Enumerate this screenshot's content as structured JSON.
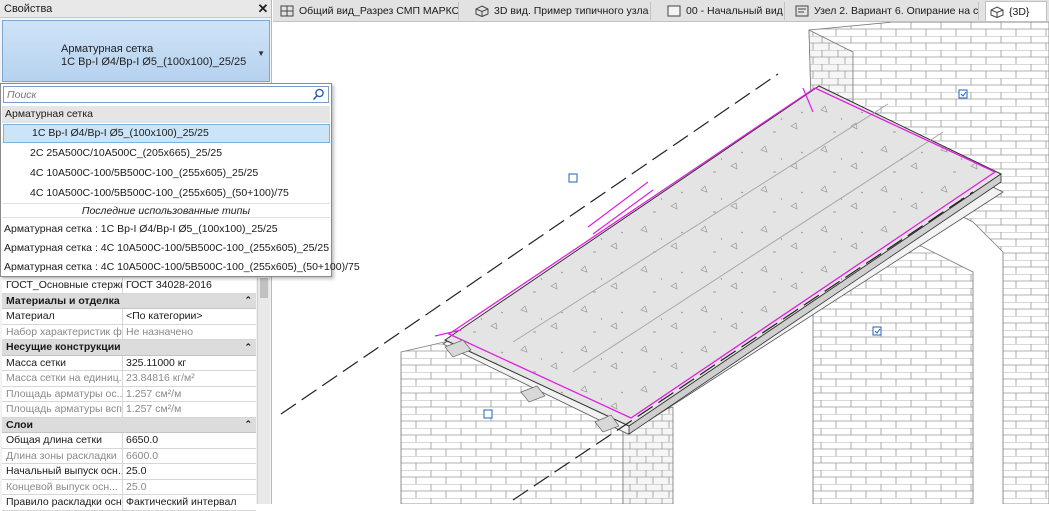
{
  "panel": {
    "title": "Свойства",
    "type_line1": "Арматурная сетка",
    "type_line2": "1С Вр-I Ø4/Вр-I Ø5_(100x100)_25/25"
  },
  "dropdown": {
    "search_placeholder": "Поиск",
    "group_label": "Арматурная сетка",
    "items": [
      "1С Вр-I Ø4/Вр-I Ø5_(100x100)_25/25",
      "2С 25А500С/10А500С_(205x665)_25/25",
      "4С 10А500С-100/5В500С-100_(255x605)_25/25",
      "4С 10А500С-100/5В500С-100_(255x605)_(50+100)/75"
    ],
    "recent_label": "Последние использованные типы",
    "recent": [
      "Арматурная сетка : 1С Вр-I Ø4/Вр-I Ø5_(100x100)_25/25",
      "Арматурная сетка : 4С 10А500С-100/5В500С-100_(255x605)_25/25",
      "Арматурная сетка : 4С 10А500С-100/5В500С-100_(255x605)_(50+100)/75"
    ]
  },
  "grid": {
    "top_row": {
      "k": "ГОСТ_Основные стержни",
      "v": "ГОСТ 34028-2016"
    },
    "groups": [
      {
        "label": "Материалы и отделка",
        "rows": [
          {
            "k": "Материал",
            "v": "<По категории>",
            "ro": false
          },
          {
            "k": "Набор характеристик ф...",
            "v": "Не назначено",
            "ro": true
          }
        ]
      },
      {
        "label": "Несущие конструкции",
        "rows": [
          {
            "k": "Масса сетки",
            "v": "325.11000 кг",
            "ro": false
          },
          {
            "k": "Масса сетки на единиц...",
            "v": "23.84816 кг/м²",
            "ro": true
          },
          {
            "k": "Площадь арматуры ос...",
            "v": "1.257 см²/м",
            "ro": true
          },
          {
            "k": "Площадь арматуры всп...",
            "v": "1.257 см²/м",
            "ro": true
          }
        ]
      },
      {
        "label": "Слои",
        "rows": [
          {
            "k": "Общая длина сетки",
            "v": "6650.0",
            "ro": false
          },
          {
            "k": "Длина зоны раскладки",
            "v": "6600.0",
            "ro": true
          },
          {
            "k": "Начальный выпуск осн...",
            "v": "25.0",
            "ro": false
          },
          {
            "k": "Концевой выпуск осн...",
            "v": "25.0",
            "ro": true
          },
          {
            "k": "Правило раскладки осн...",
            "v": "Фактический интервал",
            "ro": false
          }
        ]
      }
    ]
  },
  "tabs": [
    {
      "label": "Общий вид_Разрез СМП МАРКО...",
      "icon": "section-view-icon"
    },
    {
      "label": "3D вид. Пример типичного узла",
      "icon": "3d-view-icon"
    },
    {
      "label": "00 - Начальный вид",
      "icon": "sheet-icon"
    },
    {
      "label": "Узел 2. Вариант 6. Опирание на с...",
      "icon": "detail-view-icon"
    },
    {
      "label": "{3D}",
      "icon": "3d-view-icon",
      "active": true
    }
  ],
  "colors": {
    "selection": "#cce4f7",
    "highlight_magenta": "#e020e0",
    "type_selector_blue": "#b6d2ef"
  }
}
